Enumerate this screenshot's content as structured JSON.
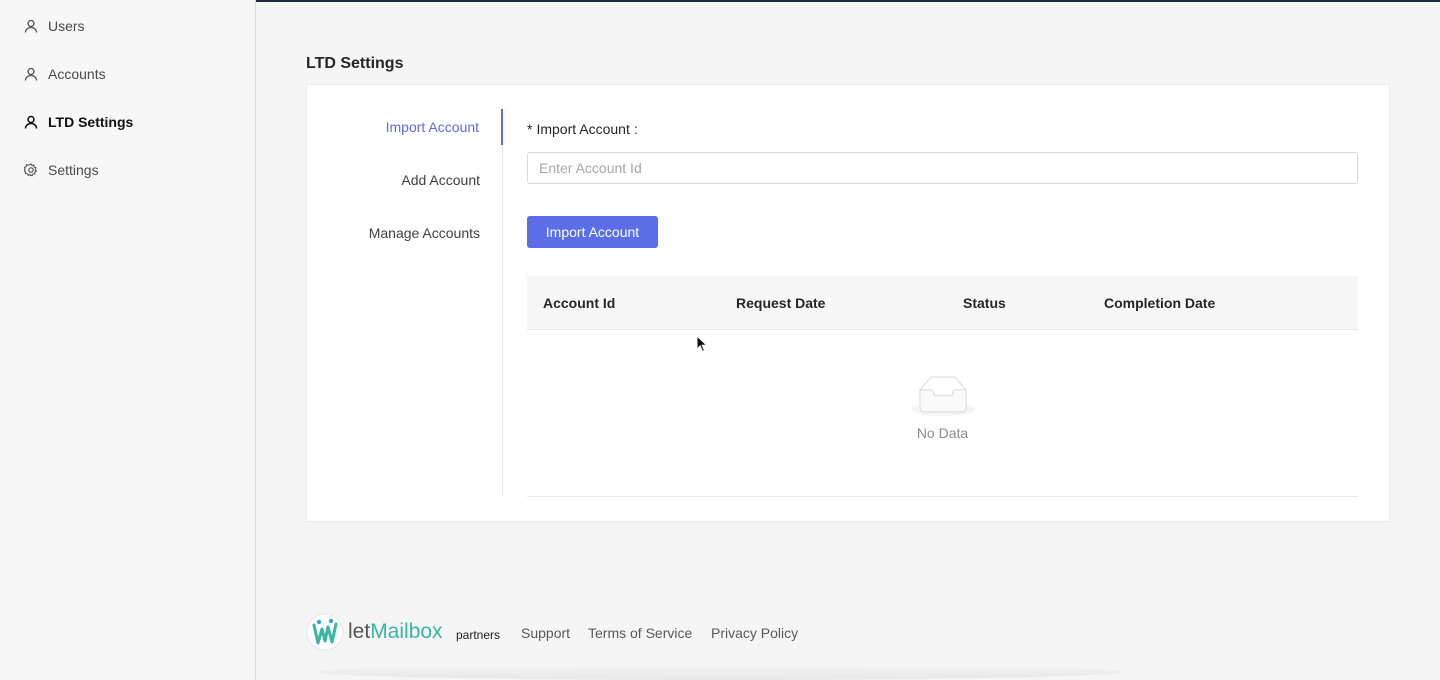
{
  "sidebar": {
    "items": [
      {
        "label": "Users",
        "icon": "user-icon",
        "active": false
      },
      {
        "label": "Accounts",
        "icon": "user-icon",
        "active": false
      },
      {
        "label": "LTD Settings",
        "icon": "user-icon",
        "active": true
      },
      {
        "label": "Settings",
        "icon": "gear-icon",
        "active": false
      }
    ]
  },
  "page": {
    "title": "LTD Settings"
  },
  "tabs": [
    {
      "label": "Import Account",
      "active": true
    },
    {
      "label": "Add Account",
      "active": false
    },
    {
      "label": "Manage Accounts",
      "active": false
    }
  ],
  "form": {
    "required_mark": "*",
    "label": "Import Account",
    "colon": ":",
    "input_placeholder": "Enter Account Id",
    "input_value": "",
    "submit_label": "Import Account"
  },
  "table": {
    "columns": [
      "Account Id",
      "Request Date",
      "Status",
      "Completion Date"
    ],
    "rows": [],
    "empty_text": "No Data"
  },
  "footer": {
    "logo_prefix": "let",
    "logo_brand": "Mailbox",
    "logo_suffix": "partners",
    "links": [
      "Support",
      "Terms of Service",
      "Privacy Policy"
    ]
  },
  "colors": {
    "accent": "#5b6ee8",
    "brand_green": "#3bb6a2",
    "sidebar_bg": "#f7f7f7"
  }
}
